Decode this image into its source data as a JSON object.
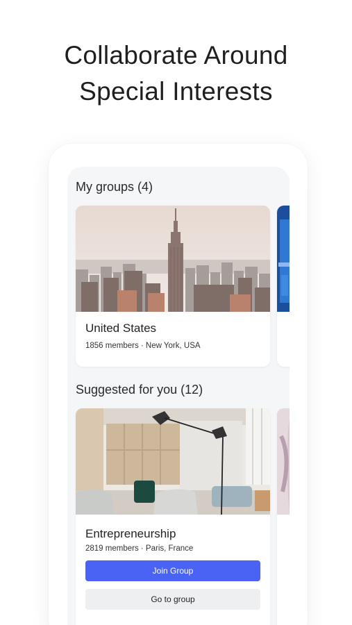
{
  "headline": {
    "line1": "Collaborate Around",
    "line2": "Special Interests"
  },
  "my_groups": {
    "title": "My groups (4)",
    "cards": [
      {
        "name": "United States",
        "meta": "1856 members · New York, USA",
        "image": "new-york-skyline-image"
      }
    ]
  },
  "suggested": {
    "title": "Suggested for you (12)",
    "cards": [
      {
        "name": "Entrepreneurship",
        "meta": "2819 members · Paris, France",
        "image": "modern-office-image",
        "join_label": "Join Group",
        "go_label": "Go to group"
      }
    ]
  },
  "colors": {
    "accent": "#4a63f5",
    "screen_bg": "#f5f6f8"
  }
}
